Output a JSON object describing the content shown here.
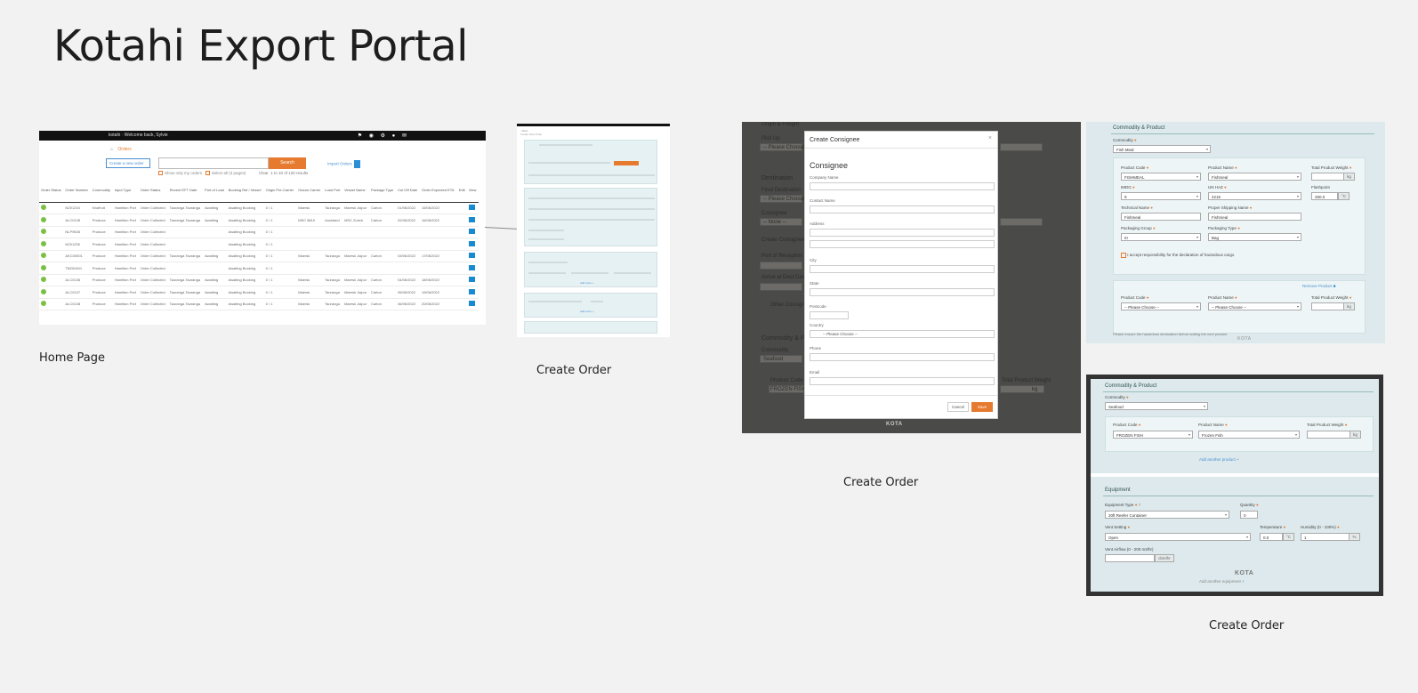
{
  "board": {
    "title": "Kotahi Export Portal",
    "captions": {
      "home": "Home Page",
      "create_order_1": "Create Order",
      "create_order_2": "Create Order",
      "create_order_3": "Create Order"
    }
  },
  "home": {
    "topbar_text": "kotahi · Welcome back, Sylvie",
    "topbar_icons": "⚑ ◉ ⚙ ● ✉",
    "home_icon": "⌂",
    "breadcrumb": "Orders",
    "create_button": "Create a new order",
    "search_button": "Search",
    "check_1": "Show only my orders",
    "check_2": "Select all (3 pages)",
    "clear": "Clear",
    "results": "1 to 10 of 120 results",
    "import_label": "Import Orders",
    "columns": [
      "Order Status",
      "Order Number",
      "Commodity",
      "Input Type",
      "Order Status",
      "Recent EFT Date",
      "Port of Load",
      "Booking Ref / Vessel",
      "Origin Pre-Carrier",
      "Ocean Carrier",
      "Load Port",
      "Vessel Name",
      "Package Type",
      "Cut Off Date",
      "Order Expected ETA",
      "Edit",
      "View"
    ],
    "rows": [
      [
        "",
        "NZ01234",
        "Kiwifruit",
        "Hamilton Port",
        "Order Collected",
        "Tauranga Tauranga",
        "Awaiting",
        "Awaiting Booking",
        "0 / 1",
        "Maersk",
        "Tauranga",
        "Maersk Jaipur",
        "Carton",
        "01/06/2022",
        "15/06/2022"
      ],
      [
        "",
        "ALC0135",
        "Produce",
        "Hamilton Port",
        "Order Collected",
        "Tauranga Tauranga",
        "Awaiting",
        "Awaiting Booking",
        "0 / 1",
        "MSC 8810",
        "Auckland",
        "MSC Zurich",
        "Carton",
        "02/06/2022",
        "16/06/2022"
      ],
      [
        "",
        "NLP9526",
        "Produce",
        "Hamilton Port",
        "Order Collected",
        "",
        "",
        "Awaiting Booking",
        "0 / 1",
        "",
        "",
        "",
        "",
        "",
        ""
      ],
      [
        "",
        "NZ01235",
        "Produce",
        "Hamilton Port",
        "Order Collected",
        "",
        "",
        "Awaiting Booking",
        "0 / 1",
        "",
        "",
        "",
        "",
        "",
        ""
      ],
      [
        "",
        "AKC00501",
        "Produce",
        "Hamilton Port",
        "Order Collected",
        "Tauranga Tauranga",
        "Awaiting",
        "Awaiting Booking",
        "0 / 1",
        "Maersk",
        "Tauranga",
        "Maersk Jaipur",
        "Carton",
        "03/06/2022",
        "17/06/2022"
      ],
      [
        "",
        "TBZ00401",
        "Produce",
        "Hamilton Port",
        "Order Collected",
        "",
        "",
        "Awaiting Booking",
        "0 / 1",
        "",
        "",
        "",
        "",
        "",
        ""
      ],
      [
        "",
        "ALC0136",
        "Produce",
        "Hamilton Port",
        "Order Collected",
        "Tauranga Tauranga",
        "Awaiting",
        "Awaiting Booking",
        "0 / 1",
        "Maersk",
        "Tauranga",
        "Maersk Jaipur",
        "Carton",
        "04/06/2022",
        "18/06/2022"
      ],
      [
        "",
        "ALC0137",
        "Produce",
        "Hamilton Port",
        "Order Collected",
        "Tauranga Tauranga",
        "Awaiting",
        "Awaiting Booking",
        "0 / 1",
        "Maersk",
        "Tauranga",
        "Maersk Jaipur",
        "Carton",
        "05/06/2022",
        "19/06/2022"
      ],
      [
        "",
        "ALC0138",
        "Produce",
        "Hamilton Port",
        "Order Collected",
        "Tauranga Tauranga",
        "Awaiting",
        "Awaiting Booking",
        "0 / 1",
        "Maersk",
        "Tauranga",
        "Maersk Jaipur",
        "Carton",
        "06/06/2022",
        "20/06/2022"
      ]
    ]
  },
  "create_order_thumb": {
    "back": "‹ Back",
    "heading": "Create New Order",
    "add_button": "Add Booking Ref",
    "add_link": "Add more +",
    "add_link_2": "Add more +"
  },
  "consignee_modal": {
    "bg_labels": [
      "Origin & Freight",
      "Pick Up",
      "-- Please Choose --",
      "Destination",
      "Final Destination",
      "-- Please Choose --",
      "Consignee",
      "-- None --",
      "Create Consignee",
      "Port of Reception",
      "Arrive at Dest Date",
      "Other Consignee",
      "Commodity & Product",
      "Commodity",
      "Seafood",
      "Product Code",
      "FROZEN FISH",
      "Total Product Weight",
      "kg"
    ],
    "title": "Create Consignee",
    "close": "×",
    "heading": "Consignee",
    "fields": [
      "Company Name",
      "Contact Name",
      "Address",
      "City",
      "State",
      "Postcode",
      "Country",
      "Phone",
      "Email"
    ],
    "country_value": "-- Please Choose --",
    "cancel": "Cancel",
    "save": "Save",
    "watermark": "KOTA"
  },
  "commodity_1": {
    "section": "Commodity & Product",
    "commodity_label": "Commodity",
    "commodity_value": "Fish Meal",
    "labels": [
      "Product Code",
      "Product Name",
      "Total Product Weight",
      "IMDG",
      "UN HAZ",
      "Flashpoint",
      "Technical Name",
      "Proper Shipping Name",
      "Packaging Group",
      "Packaging Type"
    ],
    "values": [
      "FISHMEAL",
      "Fishmeal",
      "",
      "9",
      "2216",
      "250.0",
      "Fishmeal",
      "Fishmeal",
      "III",
      "Bag"
    ],
    "units": [
      "kg",
      "°C"
    ],
    "checkbox": "I accept responsibility for the declaration of hazardous cargo",
    "remove": "Remove Product",
    "row2_labels": [
      "Product Code",
      "Product Name",
      "Total Product Weight"
    ],
    "row2_values": [
      "-- Please Choose --",
      "-- Please Choose --",
      ""
    ],
    "note": "Please ensure the hazardous declaration before adding the next product",
    "watermark": "KOTA"
  },
  "commodity_2": {
    "section": "Commodity & Product",
    "commodity_label": "Commodity",
    "commodity_value": "Seafood",
    "labels": [
      "Product Code",
      "Product Name",
      "Total Product Weight"
    ],
    "values": [
      "FROZEN FISH",
      "Frozen Fish",
      ""
    ],
    "unit": "kg",
    "add_link": "Add another product",
    "equipment": "Equipment",
    "eq_labels": [
      "Equipment Type",
      "Quantity",
      "Vent Setting",
      "Temperature",
      "Humidity (0 - 100%)",
      "Vent Airflow (0 - 200 m3/hr)"
    ],
    "eq_values": [
      "20ft Reefer Container",
      "0",
      "Open",
      "0.0",
      "1",
      ""
    ],
    "eq_units": [
      "°C",
      "%",
      "cbm/hr"
    ],
    "add_eq": "Add another equipment",
    "watermark": "KOTA"
  }
}
